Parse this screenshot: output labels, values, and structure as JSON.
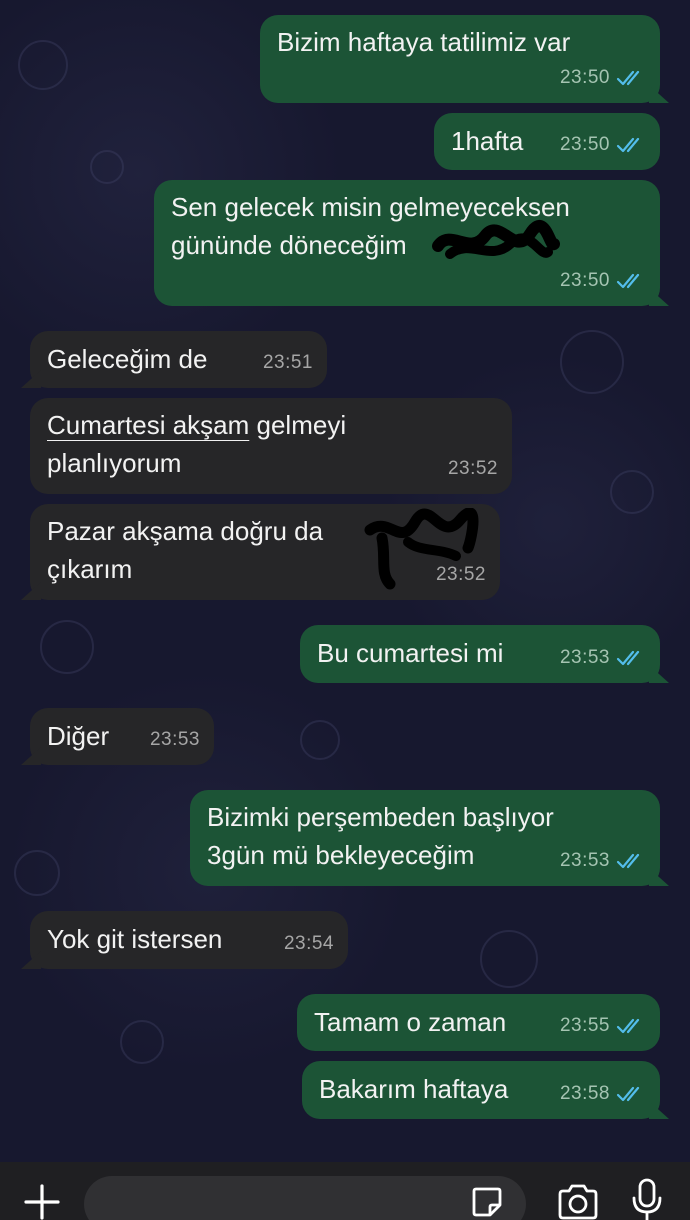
{
  "messages": [
    {
      "direction": "outgoing",
      "lines": [
        "Bizim haftaya tatilimiz var"
      ],
      "time": "23:50",
      "status": "read"
    },
    {
      "direction": "outgoing",
      "lines": [
        "1hafta"
      ],
      "time": "23:50",
      "status": "read"
    },
    {
      "direction": "outgoing",
      "lines": [
        "Sen gelecek misin gelmeyeceksen",
        "gününde döneceğim"
      ],
      "time": "23:50",
      "status": "read"
    },
    {
      "direction": "incoming",
      "lines": [
        "Geleceğim de"
      ],
      "time": "23:51"
    },
    {
      "direction": "incoming",
      "lines": [
        "Cumartesi akşam",
        " gelmeyi",
        "planlıyorum"
      ],
      "time": "23:52"
    },
    {
      "direction": "incoming",
      "lines": [
        "Pazar akşama doğru da",
        "çıkarım"
      ],
      "time": "23:52"
    },
    {
      "direction": "outgoing",
      "lines": [
        "Bu cumartesi mi"
      ],
      "time": "23:53",
      "status": "read"
    },
    {
      "direction": "incoming",
      "lines": [
        "Diğer"
      ],
      "time": "23:53"
    },
    {
      "direction": "outgoing",
      "lines": [
        "Bizimki perşembeden başlıyor",
        "3gün mü bekleyeceğim"
      ],
      "time": "23:53",
      "status": "read"
    },
    {
      "direction": "incoming",
      "lines": [
        "Yok git istersen"
      ],
      "time": "23:54"
    },
    {
      "direction": "outgoing",
      "lines": [
        "Tamam o zaman"
      ],
      "time": "23:55",
      "status": "read"
    },
    {
      "direction": "outgoing",
      "lines": [
        "Bakarım haftaya"
      ],
      "time": "23:58",
      "status": "read"
    }
  ],
  "composer": {
    "placeholder": "",
    "icons": [
      "plus-icon",
      "sticker-icon",
      "camera-icon",
      "microphone-icon"
    ]
  },
  "colors": {
    "background": "#17182f",
    "outgoing_bubble": "#1c5436",
    "incoming_bubble": "#262628",
    "read_ticks": "#53bdeb",
    "composer": "#1f1f22"
  }
}
